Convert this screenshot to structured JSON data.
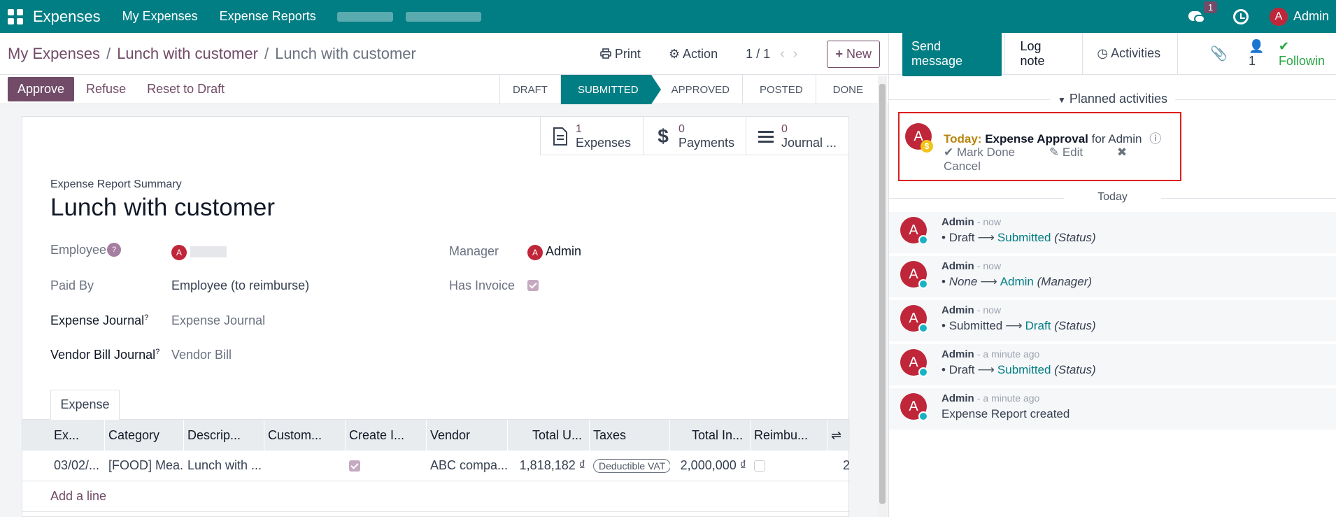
{
  "topbar": {
    "app_name": "Expenses",
    "nav": [
      "My Expenses",
      "Expense Reports"
    ],
    "chat_badge": "1",
    "user": "Admin",
    "user_initial": "A"
  },
  "breadcrumb": {
    "items": [
      "My Expenses",
      "Lunch with customer",
      "Lunch with customer"
    ],
    "sep": "/"
  },
  "control": {
    "print": "Print",
    "action": "Action",
    "pager": "1 / 1",
    "new": "New"
  },
  "statusbar": {
    "approve": "Approve",
    "refuse": "Refuse",
    "reset": "Reset to Draft",
    "stages": [
      "DRAFT",
      "SUBMITTED",
      "APPROVED",
      "POSTED",
      "DONE"
    ],
    "active_stage": "SUBMITTED"
  },
  "smart_buttons": [
    {
      "num": "1",
      "label": "Expenses",
      "icon": "document-icon"
    },
    {
      "num": "0",
      "label": "Payments",
      "icon": "dollar-icon"
    },
    {
      "num": "0",
      "label": "Journal ...",
      "icon": "list-icon"
    }
  ],
  "form": {
    "summary_label": "Expense Report Summary",
    "title": "Lunch with customer",
    "employee_label": "Employee",
    "employee_help": "?",
    "employee_initial": "A",
    "manager_label": "Manager",
    "manager_value": "Admin",
    "manager_initial": "A",
    "paid_by_label": "Paid By",
    "paid_by_value": "Employee (to reimburse)",
    "has_invoice_label": "Has Invoice",
    "expense_journal_label": "Expense Journal",
    "expense_journal_value": "Expense Journal",
    "vendor_bill_journal_label": "Vendor Bill Journal",
    "vendor_bill_journal_value": "Vendor Bill",
    "help_mark": "?"
  },
  "tab": {
    "label": "Expense"
  },
  "table": {
    "columns": [
      "Ex...",
      "Category",
      "Descrip...",
      "Custom...",
      "Create I...",
      "Vendor",
      "Total U...",
      "Taxes",
      "Total In...",
      "Reimbu..."
    ],
    "row": {
      "date": "03/02/...",
      "category": "[FOOD] Mea...",
      "description": "Lunch with ...",
      "vendor": "ABC compa...",
      "total_untaxed": "1,818,182 ₫",
      "tax": "Deductible VAT",
      "total_incl": "2,000,000 ₫",
      "trailing": "2"
    },
    "add_line": "Add a line"
  },
  "chatter": {
    "send_message": "Send message",
    "log_note": "Log note",
    "activities": "Activities",
    "followers_count": "1",
    "following": "Followin",
    "planned_activities": "Planned activities",
    "activity": {
      "initial": "A",
      "today": "Today:",
      "name": "Expense Approval",
      "for": "for Admin",
      "mark_done": "Mark Done",
      "edit": "Edit",
      "cancel": "Cancel"
    },
    "today_divider": "Today",
    "messages": [
      {
        "author": "Admin",
        "time": "- now",
        "old": "Draft",
        "new": "Submitted",
        "field": "(Status)"
      },
      {
        "author": "Admin",
        "time": "- now",
        "old": "None",
        "new": "Admin",
        "field": "(Manager)"
      },
      {
        "author": "Admin",
        "time": "- now",
        "old": "Submitted",
        "new": "Draft",
        "field": "(Status)"
      },
      {
        "author": "Admin",
        "time": "- a minute ago",
        "old": "Draft",
        "new": "Submitted",
        "field": "(Status)"
      },
      {
        "author": "Admin",
        "time": "- a minute ago",
        "text": "Expense Report created"
      }
    ]
  },
  "colors": {
    "navbar": "#017e84",
    "primary": "#714b67",
    "avatar": "#c0263a",
    "highlight_border": "#dc2020"
  }
}
